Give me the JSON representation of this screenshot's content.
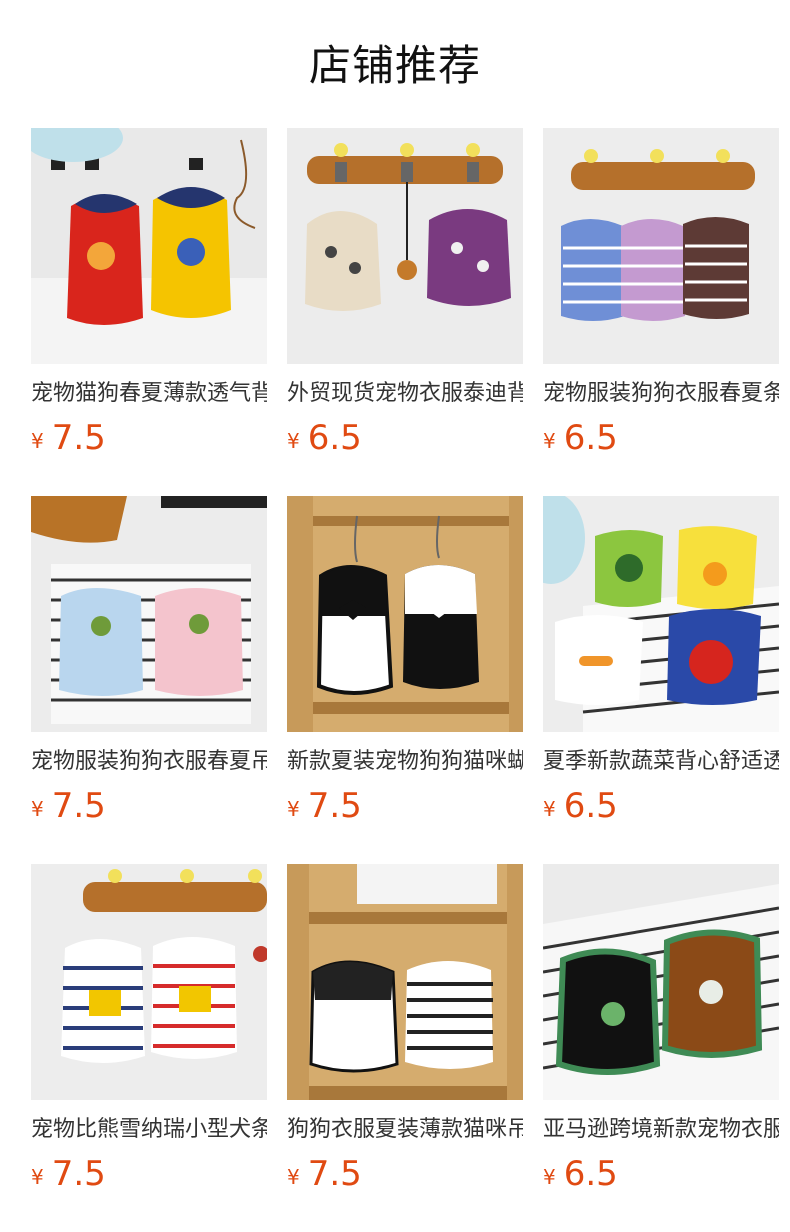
{
  "section_title": "店铺推荐",
  "products": [
    {
      "name": "宠物猫狗春夏薄款透气背心",
      "currency": "¥",
      "price": "7.5",
      "image": "two printed dog vests on white rug",
      "colors": [
        "#d9251c",
        "#f5c400"
      ]
    },
    {
      "name": "外贸现货宠物衣服泰迪背心",
      "currency": "¥",
      "price": "6.5",
      "image": "two printed dog vests hanging on wooden rack",
      "colors": [
        "#e8dcc6",
        "#7a3a80"
      ]
    },
    {
      "name": "宠物服装狗狗衣服春夏条纹背心",
      "currency": "¥",
      "price": "6.5",
      "image": "three striped vests hanging on wooden rack",
      "colors": [
        "#6f8fd6",
        "#c49ad0",
        "#5d3a35"
      ]
    },
    {
      "name": "宠物服装狗狗衣服春夏吊带裙",
      "currency": "¥",
      "price": "7.5",
      "image": "two embroidered dresses on hangers",
      "colors": [
        "#b9d6ee",
        "#f4c4cd"
      ]
    },
    {
      "name": "新款夏装宠物狗狗猫咪蝴蝶结吊带",
      "currency": "¥",
      "price": "7.5",
      "image": "black and white bow dresses on wooden shelf",
      "colors": [
        "#ffffff",
        "#111111"
      ]
    },
    {
      "name": "夏季新款蔬菜背心舒适透气",
      "currency": "¥",
      "price": "6.5",
      "image": "four vegetable print vests on striped rug",
      "colors": [
        "#8cc63f",
        "#f7e03c",
        "#ffffff",
        "#2a49a8"
      ]
    },
    {
      "name": "宠物比熊雪纳瑞小型犬条纹衣服",
      "currency": "¥",
      "price": "7.5",
      "image": "two striped vests with fries print on rack",
      "colors": [
        "#2a3d7a",
        "#d62b2b"
      ]
    },
    {
      "name": "狗狗衣服夏装薄款猫咪吊带背心",
      "currency": "¥",
      "price": "7.5",
      "image": "two camisole dresses on wooden shelf",
      "colors": [
        "#ffffff",
        "#222222"
      ]
    },
    {
      "name": "亚马逊跨境新款宠物衣服背心",
      "currency": "¥",
      "price": "6.5",
      "image": "black and brown vests on striped rug",
      "colors": [
        "#111111",
        "#8b4a17"
      ]
    }
  ]
}
